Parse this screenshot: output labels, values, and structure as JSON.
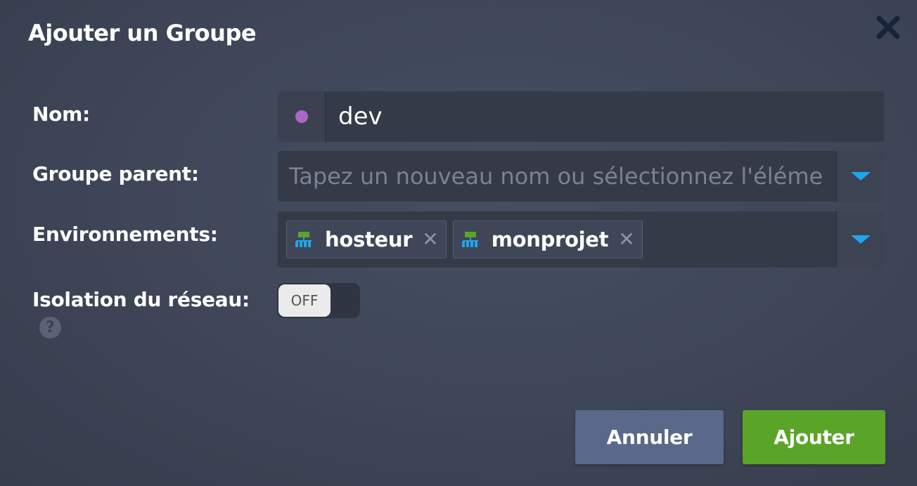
{
  "dialog": {
    "title": "Ajouter un Groupe",
    "close_icon": "close-icon"
  },
  "form": {
    "name": {
      "label": "Nom:",
      "value": "dev",
      "color": "#a968c8"
    },
    "parent_group": {
      "label": "Groupe parent:",
      "placeholder": "Tapez un nouveau nom ou sélectionnez l'élément"
    },
    "environments": {
      "label": "Environnements:",
      "tags": [
        {
          "label": "hosteur",
          "icon": "environment-icon"
        },
        {
          "label": "monprojet",
          "icon": "environment-icon"
        }
      ]
    },
    "network_isolation": {
      "label": "Isolation du réseau:",
      "toggle_state": "OFF",
      "help_symbol": "?"
    }
  },
  "actions": {
    "cancel_label": "Annuler",
    "submit_label": "Ajouter"
  },
  "colors": {
    "accent": "#1ea6ec",
    "submit": "#5aa528",
    "cancel": "#5a6889"
  }
}
